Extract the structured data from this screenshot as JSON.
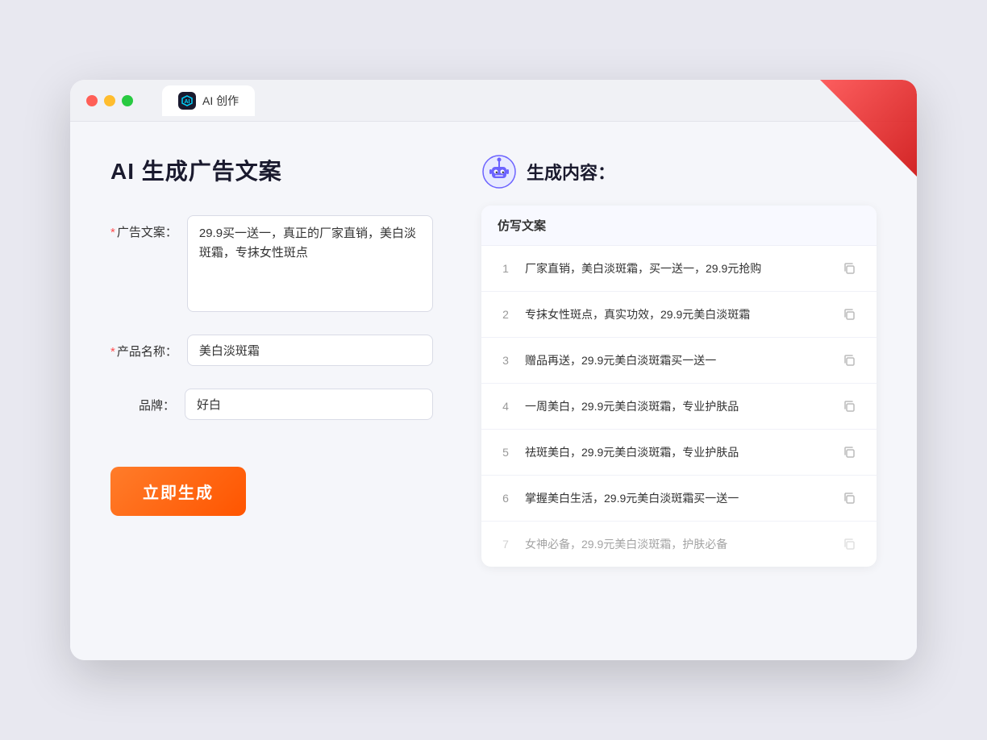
{
  "window": {
    "tab_label": "AI 创作"
  },
  "left": {
    "page_title": "AI 生成广告文案",
    "fields": [
      {
        "id": "ad_copy",
        "label": "广告文案：",
        "required": true,
        "type": "textarea",
        "value": "29.9买一送一，真正的厂家直销，美白淡斑霜，专抹女性斑点"
      },
      {
        "id": "product_name",
        "label": "产品名称：",
        "required": true,
        "type": "input",
        "value": "美白淡斑霜"
      },
      {
        "id": "brand",
        "label": "品牌：",
        "required": false,
        "type": "input",
        "value": "好白"
      }
    ],
    "generate_btn": "立即生成"
  },
  "right": {
    "title": "生成内容：",
    "table_header": "仿写文案",
    "results": [
      {
        "num": 1,
        "text": "厂家直销，美白淡斑霜，买一送一，29.9元抢购"
      },
      {
        "num": 2,
        "text": "专抹女性斑点，真实功效，29.9元美白淡斑霜"
      },
      {
        "num": 3,
        "text": "赠品再送，29.9元美白淡斑霜买一送一"
      },
      {
        "num": 4,
        "text": "一周美白，29.9元美白淡斑霜，专业护肤品"
      },
      {
        "num": 5,
        "text": "祛斑美白，29.9元美白淡斑霜，专业护肤品"
      },
      {
        "num": 6,
        "text": "掌握美白生活，29.9元美白淡斑霜买一送一"
      },
      {
        "num": 7,
        "text": "女神必备，29.9元美白淡斑霜，护肤必备",
        "dimmed": true
      }
    ]
  },
  "colors": {
    "orange": "#ff6b1a",
    "accent": "#667eea"
  }
}
